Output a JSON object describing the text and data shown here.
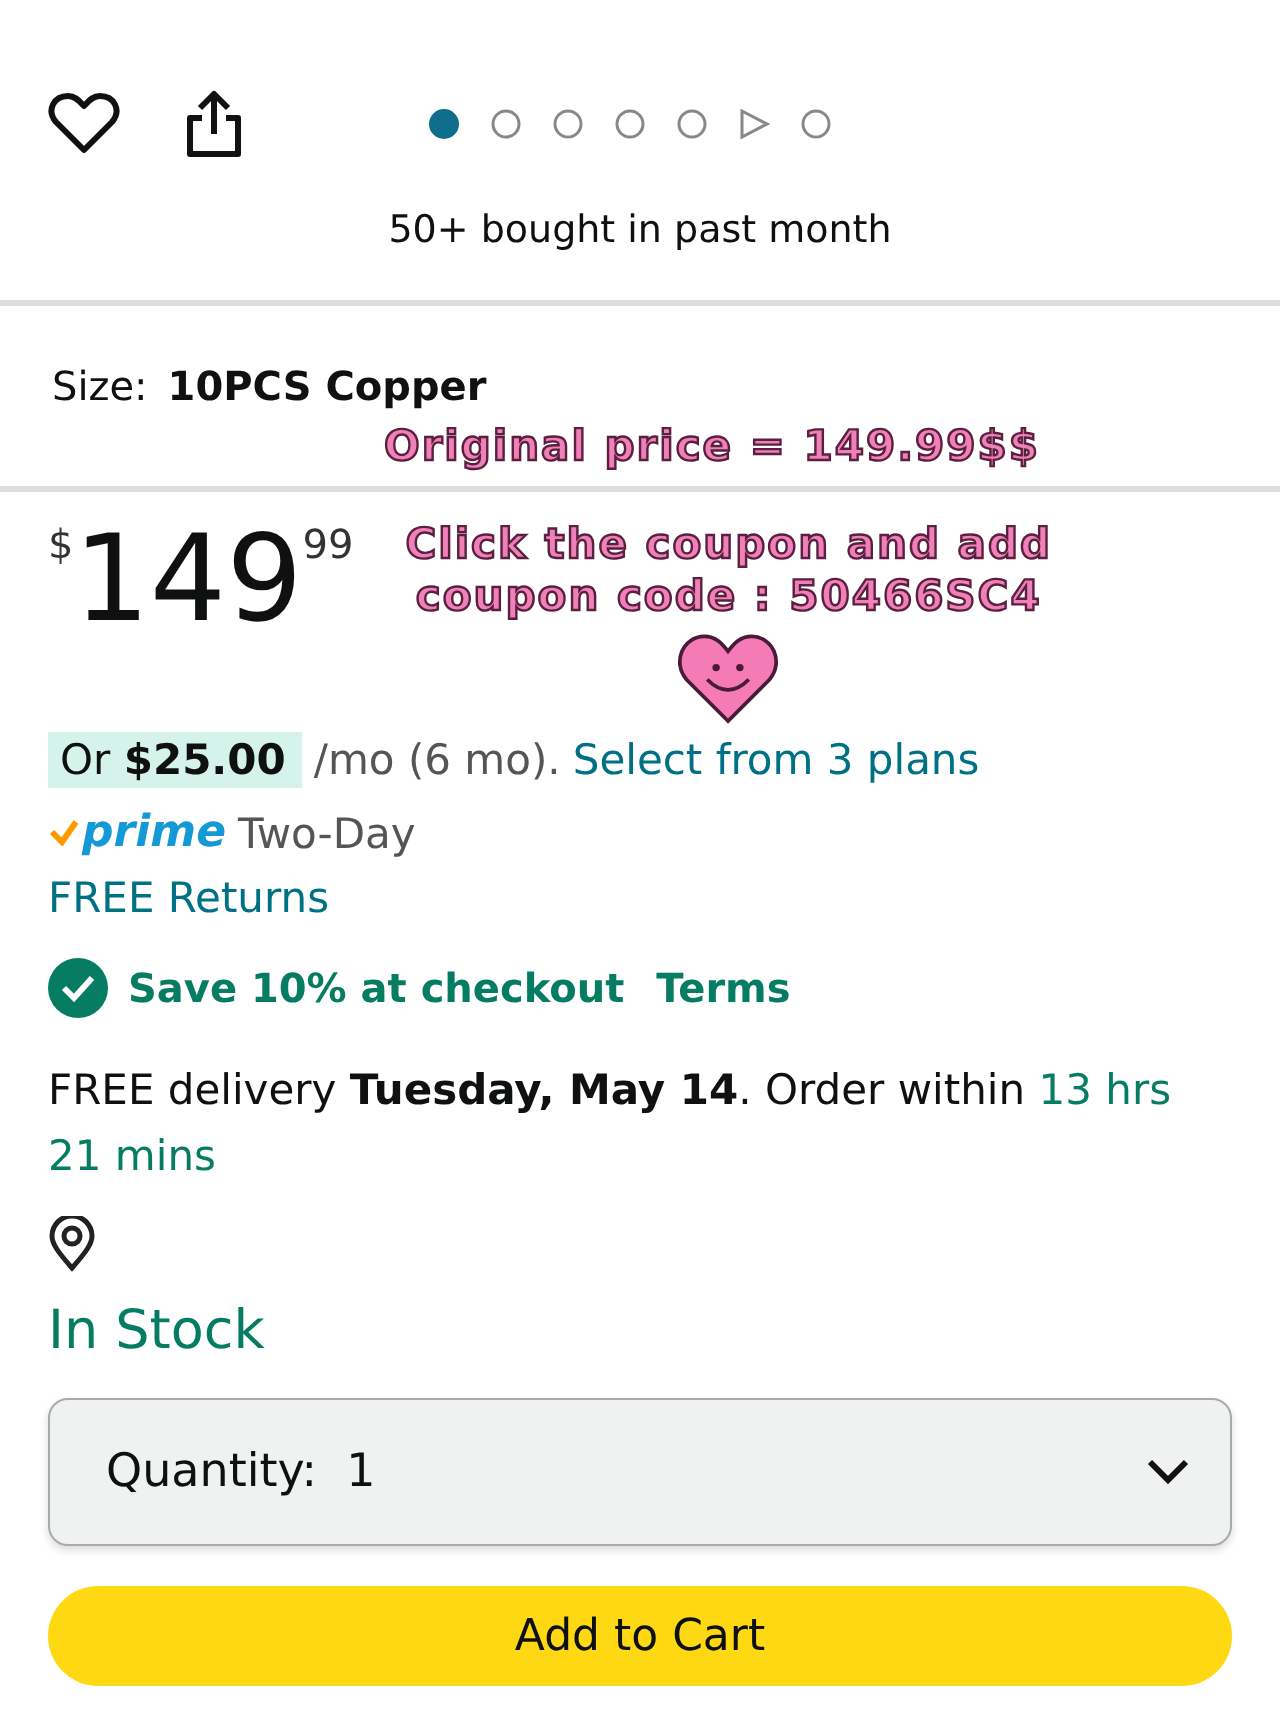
{
  "gallery_dots": [
    {
      "kind": "dot",
      "selected": true
    },
    {
      "kind": "dot",
      "selected": false
    },
    {
      "kind": "dot",
      "selected": false
    },
    {
      "kind": "dot",
      "selected": false
    },
    {
      "kind": "dot",
      "selected": false
    },
    {
      "kind": "video",
      "selected": false
    },
    {
      "kind": "dot",
      "selected": false
    }
  ],
  "bought_note": "50+ bought in past month",
  "size": {
    "label": "Size:",
    "value": "10PCS Copper"
  },
  "price": {
    "currency": "$",
    "whole": "149",
    "fraction": "99"
  },
  "annotations": [
    "Original price = 149.99$$",
    "Click the coupon and add",
    "coupon code : 50466SC4"
  ],
  "installments": {
    "offer": "Or **$25.00**",
    "terms": "/mo (6 mo).",
    "link": "Select from 3 plans"
  },
  "prime": {
    "logo": "prime",
    "speed": "Two-Day"
  },
  "returns": "FREE Returns",
  "coupon": {
    "text": "Save 10% at checkout",
    "link": "Terms"
  },
  "delivery": {
    "text": "FREE delivery **Tuesday, May 14**. Order within",
    "countdown": "13 hrs 21 mins"
  },
  "stock": "In Stock",
  "quantity": {
    "label": "Quantity:",
    "value": "1"
  },
  "cart_button": "Add to Cart"
}
